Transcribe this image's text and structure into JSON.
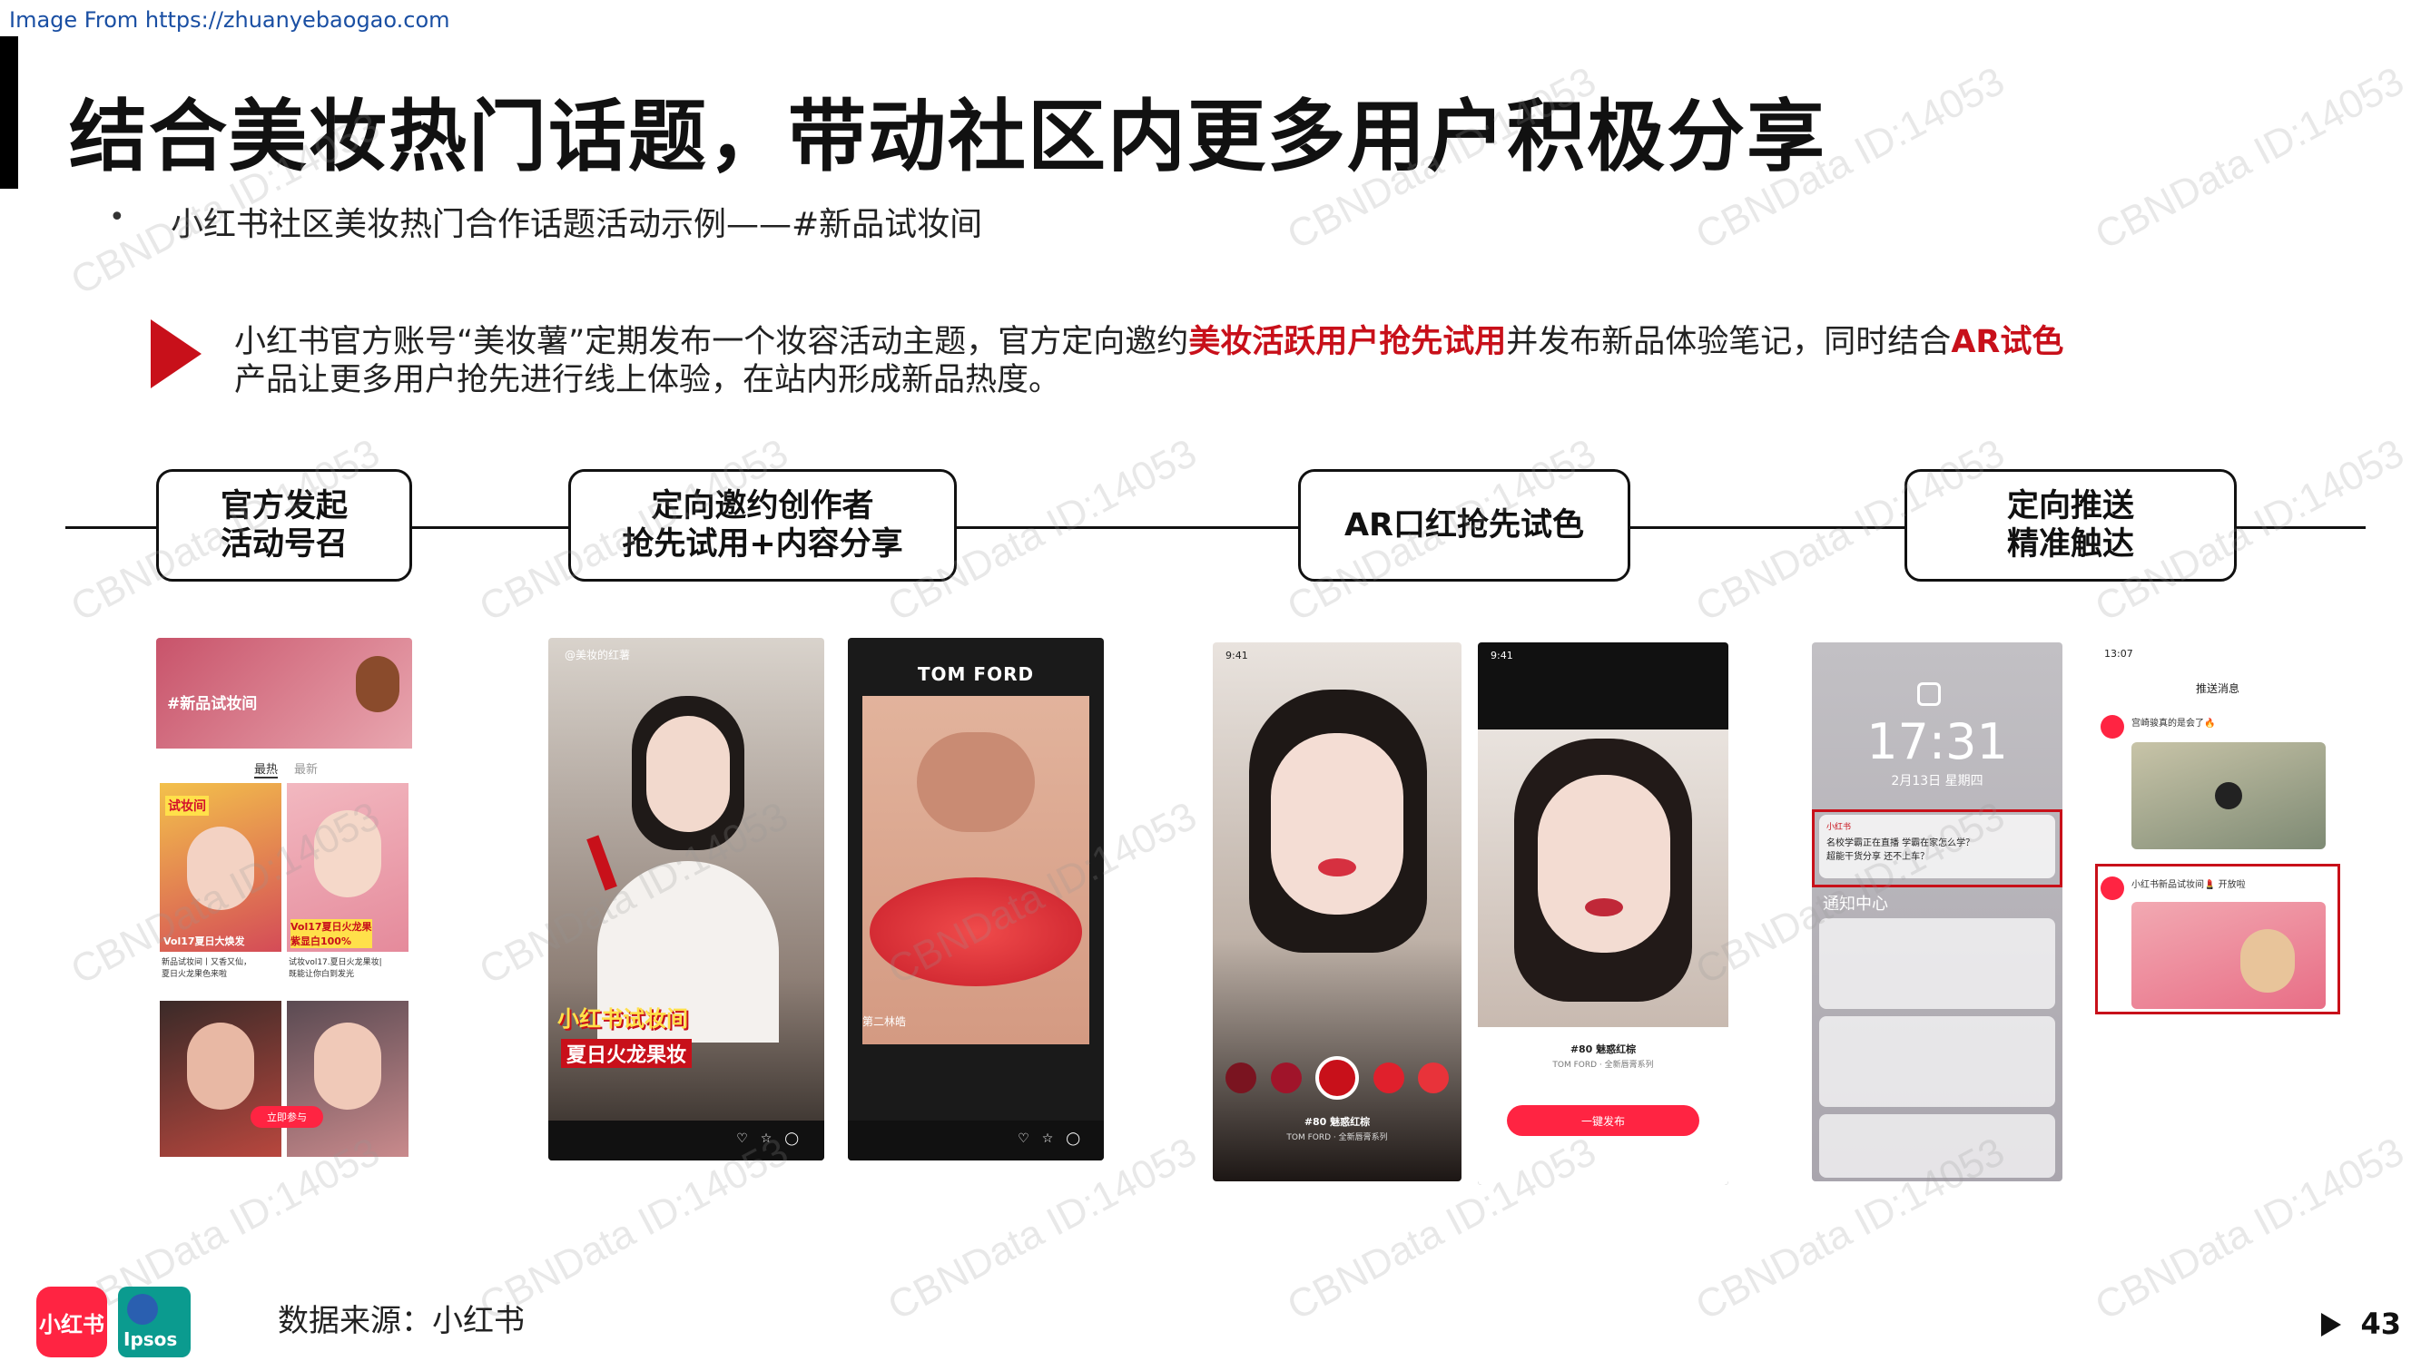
{
  "source_url": "Image From https://zhuanyebaogao.com",
  "title": "结合美妆热门话题，带动社区内更多用户积极分享",
  "subtitle_bullet": "•",
  "subtitle": "小红书社区美妆热门合作话题活动示例——#新品试妆间",
  "description": {
    "part1": "小红书官方账号“美妆薯”定期发布一个妆容活动主题，官方定向邀约",
    "highlight1": "美妆活跃用户抢先试用",
    "part2": "并发布新品体验笔记，同时结合",
    "highlight2": "AR试色",
    "part3": "产品让更多用户抢先进行线上体验，在站内形成新品热度。"
  },
  "steps": [
    {
      "label": "官方发起\n活动号召"
    },
    {
      "label": "定向邀约创作者\n抢先试用+内容分享"
    },
    {
      "label": "AR口红抢先试色"
    },
    {
      "label": "定向推送\n精准触达"
    }
  ],
  "screens": {
    "s1": {
      "topic": "#新品试妆间",
      "tab_hot": "最热",
      "tab_new": "最新",
      "tag": "试妆间",
      "card1": "Vol17夏日大焕发",
      "card2": "Vol17夏日火龙果\n紫显白100%",
      "note1": "新品试妆间丨又香又仙，\n夏日火龙果色来啦",
      "note2": "试妆vol17.夏日火龙果妆|\n既能让你白到发光",
      "join_btn": "立即参与"
    },
    "s2": {
      "account": "@美妆的红薯",
      "caption": "小红书试妆间",
      "banner": "夏日火龙果妆"
    },
    "s3": {
      "brand": "TOM FORD",
      "user": "第二林皓"
    },
    "s4": {
      "time": "9:41",
      "product": "#80 魅惑红棕",
      "brand_line": "TOM FORD · 全新唇膏系列"
    },
    "s5": {
      "time": "9:41",
      "product": "#80 魅惑红棕",
      "brand_line": "TOM FORD · 全新唇膏系列",
      "publish": "一键发布"
    },
    "s6": {
      "clock": "17:31",
      "date": "2月13日 星期四",
      "notif_center": "通知中心",
      "app": "小红书",
      "notif_text": "名校学霸正在直播 学霸在家怎么学？\n超能干货分享 还不上车？"
    },
    "s7": {
      "time": "13:07",
      "header": "推送消息",
      "msg1": "宫崎骏真的是会了🔥",
      "msg2": "小红书新品试妆间💄 开放啦"
    }
  },
  "watermark_text": "CBNData ID:14053",
  "footer_source": "数据来源：小红书",
  "logo_xhs": "小红书",
  "logo_ipsos": "Ipsos",
  "page_number": "43",
  "colors": {
    "accent_red": "#c8101a",
    "xhs_red": "#ff2442",
    "ipsos_teal": "#0b9b8f"
  }
}
